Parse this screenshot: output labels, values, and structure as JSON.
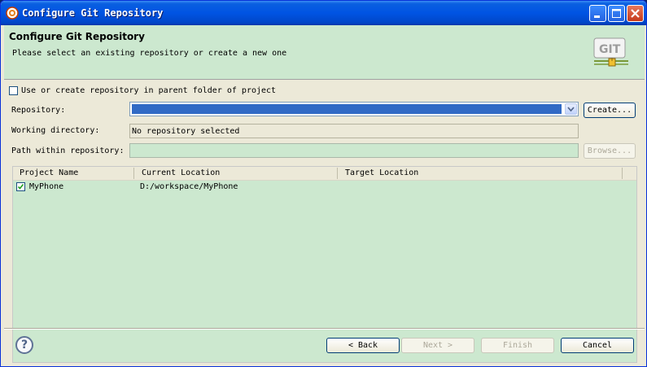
{
  "window": {
    "title": "Configure Git Repository"
  },
  "header": {
    "title": "Configure Git Repository",
    "subtitle": "Please select an existing repository or create a new one"
  },
  "form": {
    "use_parent_label": "Use or create repository in parent folder of project",
    "repository_label": "Repository:",
    "repository_value": "",
    "create_label": "Create...",
    "working_dir_label": "Working directory:",
    "working_dir_value": "No repository selected",
    "path_label": "Path within repository:",
    "path_value": "",
    "browse_label": "Browse..."
  },
  "table": {
    "columns": [
      "Project Name",
      "Current Location",
      "Target Location"
    ],
    "rows": [
      {
        "checked": true,
        "project": "MyPhone",
        "current": "D:/workspace/MyPhone",
        "target": ""
      }
    ]
  },
  "footer": {
    "back_label": "< Back",
    "next_label": "Next >",
    "finish_label": "Finish",
    "cancel_label": "Cancel"
  },
  "colors": {
    "accent": "#cce8cf",
    "titlebar": "#0054e3",
    "selection": "#316ac5"
  }
}
